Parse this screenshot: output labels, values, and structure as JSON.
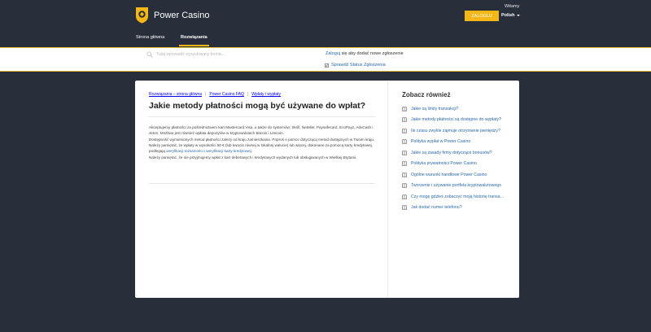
{
  "header": {
    "brand": "Power Casino",
    "welcome": "Witamy",
    "login_button": "ZALOGUJ",
    "language": "Polish",
    "nav": {
      "home": "Strona główna",
      "solutions": "Rozwiązania"
    }
  },
  "colors": {
    "accent": "#f5b617",
    "link": "#2a6aa8",
    "background": "#282f3b"
  },
  "search": {
    "placeholder": "Tutaj wprowadź wyszukiwany termin..."
  },
  "login_prompt": {
    "link": "Zaloguj",
    "rest": " się aby dodać nowe zgłoszenie"
  },
  "status_link": "Sprawdź Status Zgłoszenia",
  "breadcrumbs": [
    "Rozwiązania – strona główna",
    "Power Casino FAQ",
    "Wpłaty i wypłaty"
  ],
  "article": {
    "title": "Jakie metody płatności mogą być używane do wpłat?",
    "p1": "Akceptujemy płatności za pośrednictwem kart Mastercard,Visa, a także do systemów: Skrill, Neteller, Paysafecard, EcoPayz, AdvCash i Jeton. Możliwa jest również wpłata depozytów w kryptowalutach Bitcoin i Litecoin.",
    "p2": "Dostępność wymienionych metod płatności zależy od kraju zamieszkania. Poproś o pomoc dotyczącą metod dostępnych w Twoim kraju.",
    "p3_before": "Należy pamiętać, że wpłaty w wysokości 50 € (lub kwocie równej w lokalnej walucie) lub więcej, dokonane za pomocą karty kredytowej, podlegają ",
    "p3_link": "weryfikacji tożsamości i weryfikacji karty kredytowej",
    "p3_after": ".",
    "p4": "Należy pamiętać, że nie przyjmujemy wpłat z kart debetowych i kredytowych wydanych lub obsługiwanych w Wielkiej Brytanii."
  },
  "related": {
    "title": "Zobacz również",
    "items": [
      "Jakie są limity transakcji?",
      "Jakie metody płatności są dostępne do wypłaty?",
      "Ile czasu zwykle zajmuje otrzymanie pieniędzy?",
      "Polityka wypłat w Power Casino",
      "Jakie są zasady firmy dotyczące bonusów?",
      "Polityka prywatności Power Casino",
      "Ogólne warunki handlowe Power Casino",
      "Tworzenie i używanie portfela kryptowalutowego",
      "Czy mogę gdzieś zobaczyć moją historię transakcji?",
      "Jak dodać numer telefonu?"
    ]
  }
}
